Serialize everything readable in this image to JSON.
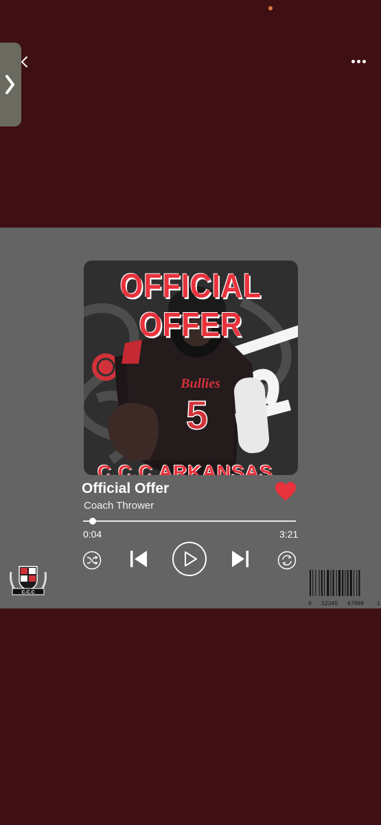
{
  "artwork": {
    "headline": "OFFICIAL OFFER",
    "bottom_text": "C.C.C ARKANSAS",
    "jersey_name": "Bullies",
    "jersey_number": "5"
  },
  "track": {
    "title": "Official Offer",
    "artist": "Coach Thrower",
    "elapsed": "0:04",
    "duration": "3:21",
    "progress": 0.03
  },
  "logo": {
    "text": "C.C.C"
  },
  "barcode": {
    "digits": [
      "0",
      "12345",
      "67890",
      "1"
    ]
  },
  "colors": {
    "background": "#3f1013",
    "card": "#646464",
    "accent": "#e8323c"
  }
}
